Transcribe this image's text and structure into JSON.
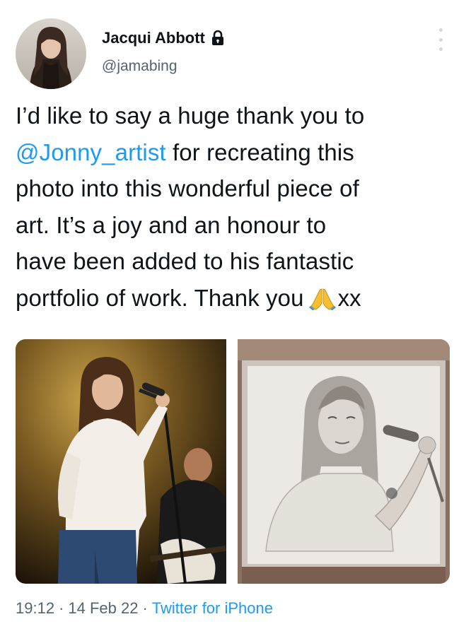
{
  "author": {
    "name": "Jacqui Abbott",
    "handle": "@jamabing",
    "protected_icon": "lock-icon",
    "avatar_icon": "avatar"
  },
  "tweet": {
    "line1": "I’d like to say a huge thank you to",
    "mention": "@Jonny_artist",
    "line2_rest": " for recreating this",
    "line3": "photo into this wonderful piece of",
    "line4": "art. It’s a joy and an honour to",
    "line5": "have been added to his fantastic",
    "line6_start": "portfolio of work. Thank you",
    "emoji": "folded-hands-icon",
    "line6_end": "xx"
  },
  "media": [
    {
      "description_icon": "concert-photo"
    },
    {
      "description_icon": "pencil-drawing"
    }
  ],
  "meta": {
    "time": "19:12",
    "separator1": "·",
    "date": "14 Feb 22",
    "separator2": "·",
    "source": "Twitter for iPhone"
  },
  "colors": {
    "accent": "#1d9bf0",
    "text": "#0f1419",
    "secondary": "#536471"
  }
}
